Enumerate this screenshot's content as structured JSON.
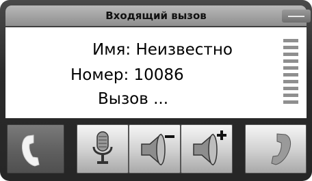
{
  "window": {
    "title": "Входящий вызов"
  },
  "call": {
    "name_line": "Имя: Неизвестно",
    "number_line": "Номер: 10086",
    "status_line": "Вызов ..."
  },
  "signal": {
    "bar_count": 10
  },
  "toolbar": {
    "buttons": [
      {
        "id": "answer",
        "icon": "phone-answer-icon"
      },
      {
        "id": "mute",
        "icon": "microphone-icon"
      },
      {
        "id": "volume_down",
        "icon": "speaker-minus-icon"
      },
      {
        "id": "volume_up",
        "icon": "speaker-plus-icon"
      },
      {
        "id": "hang_up",
        "icon": "phone-hangup-icon"
      }
    ]
  },
  "colors": {
    "frame": "#2b2b2b",
    "panel": "#ffffff",
    "button_light": "#e8e8e8",
    "button_dark": "#5f5f5f",
    "signal_bar": "#8f8f8f"
  }
}
